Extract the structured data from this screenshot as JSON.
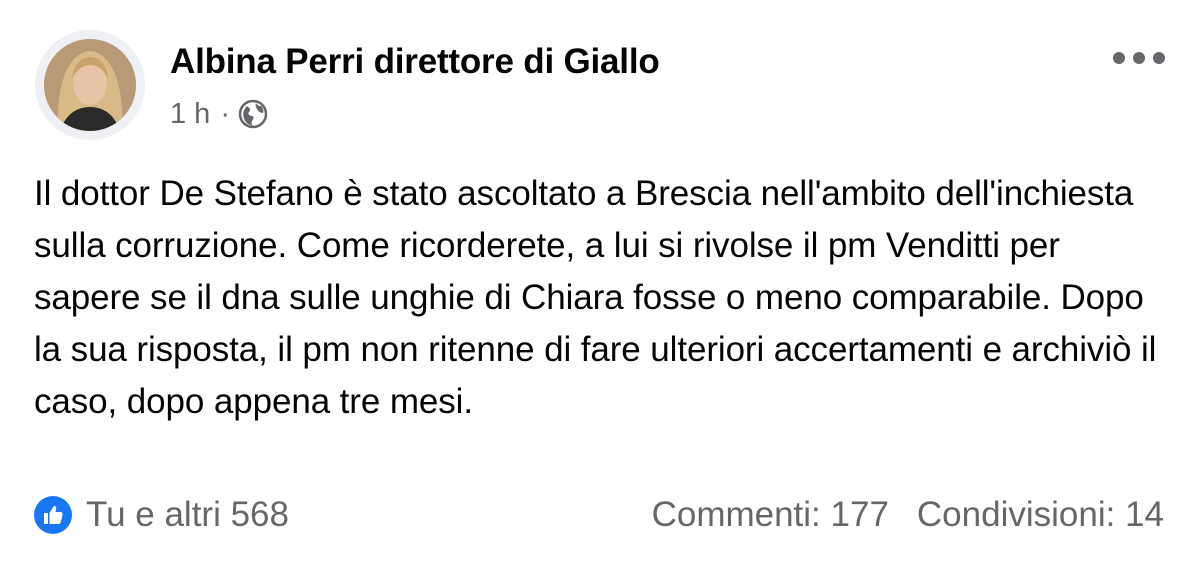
{
  "post": {
    "author": "Albina Perri direttore di Giallo",
    "time": "1 h",
    "separator": "·",
    "privacy_icon": "globe-icon",
    "more_icon": "more-horizontal-icon",
    "text": "Il dottor De Stefano è stato ascoltato a Brescia nell'ambito dell'inchiesta sulla corruzione. Come ricorderete, a lui si rivolse il pm Venditti per sapere se il dna sulle unghie di Chiara fosse o meno comparabile. Dopo la sua risposta, il pm non ritenne di fare ulteriori accertamenti e archiviò il caso, dopo appena tre mesi."
  },
  "footer": {
    "reaction_icon": "like-icon",
    "reactions_label": "Tu e altri 568",
    "comments_label": "Commenti: 177",
    "shares_label": "Condivisioni: 14"
  },
  "colors": {
    "text": "#050505",
    "secondary": "#65676b",
    "like_blue": "#1877f2"
  }
}
